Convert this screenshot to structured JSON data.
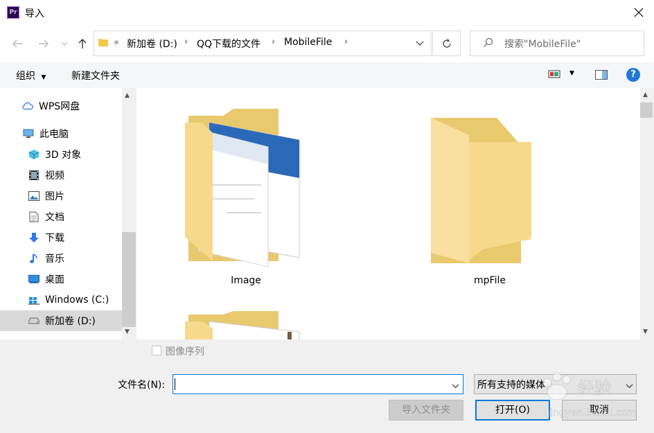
{
  "window": {
    "title": "导入",
    "app_icon_text": "Pr"
  },
  "nav": {
    "back_icon": "arrow-left-icon",
    "forward_icon": "arrow-right-icon",
    "up_icon": "arrow-up-icon",
    "breadcrumb_overflow": "«",
    "breadcrumbs": [
      "新加卷 (D:)",
      "QQ下载的文件",
      "MobileFile"
    ],
    "search_placeholder": "搜索\"MobileFile\""
  },
  "toolbar": {
    "organize": "组织",
    "new_folder": "新建文件夹",
    "help": "?"
  },
  "sidebar": {
    "items": [
      {
        "label": "WPS网盘",
        "icon": "cloud-icon"
      },
      {
        "label": "此电脑",
        "icon": "computer-icon"
      },
      {
        "label": "3D 对象",
        "icon": "cube-icon"
      },
      {
        "label": "视频",
        "icon": "film-icon"
      },
      {
        "label": "图片",
        "icon": "picture-icon"
      },
      {
        "label": "文档",
        "icon": "document-icon"
      },
      {
        "label": "下载",
        "icon": "download-icon"
      },
      {
        "label": "音乐",
        "icon": "music-icon"
      },
      {
        "label": "桌面",
        "icon": "desktop-icon"
      },
      {
        "label": "Windows (C:)",
        "icon": "drive-c-icon"
      },
      {
        "label": "新加卷 (D:)",
        "icon": "drive-d-icon"
      }
    ],
    "selected": "新加卷 (D:)"
  },
  "content": {
    "files": [
      {
        "name": "Image",
        "type": "folder-with-preview"
      },
      {
        "name": "mpFile",
        "type": "folder"
      },
      {
        "name": "",
        "type": "folder-with-preview"
      }
    ]
  },
  "bottom": {
    "image_sequence_label": "图像序列",
    "filename_label": "文件名(N):",
    "filename_value": "",
    "filetype_value": "所有支持的媒体",
    "import_folder_btn": "导入文件夹",
    "open_btn": "打开(O)",
    "cancel_btn": "取消"
  },
  "watermark": {
    "text": "Bai 经验",
    "url_text": "jingyan.baidu.com"
  }
}
